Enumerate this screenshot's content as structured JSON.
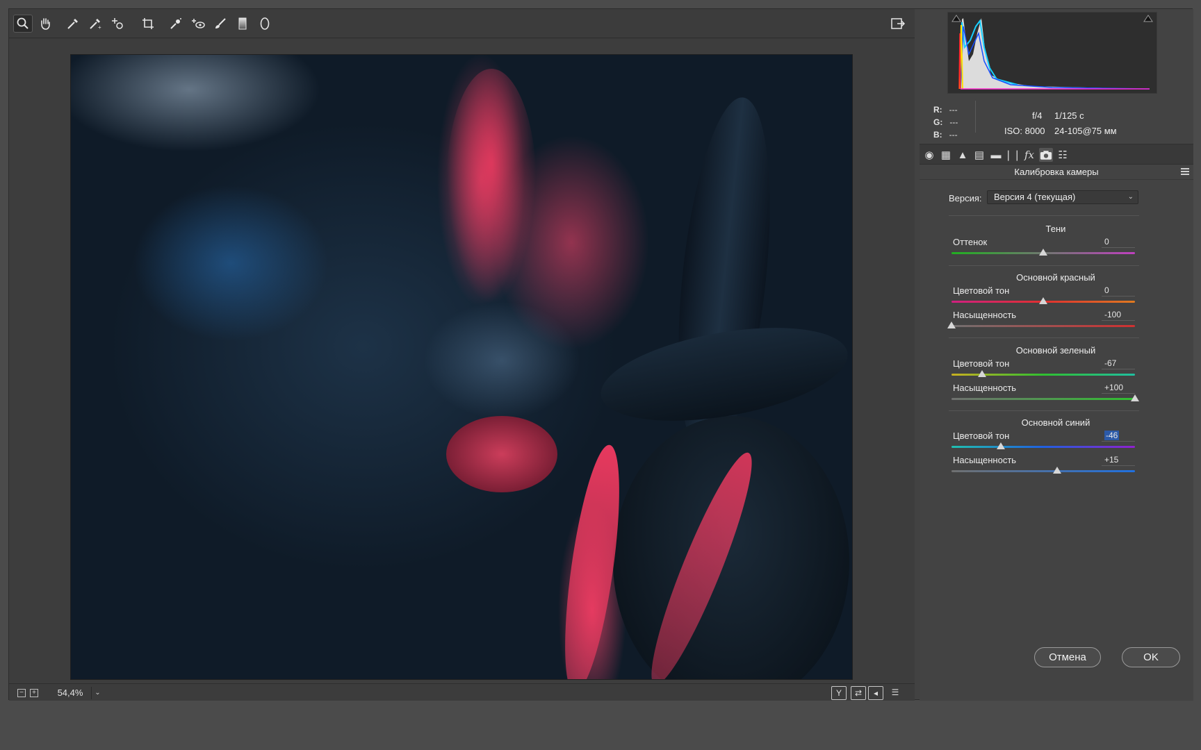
{
  "toolbar": {
    "tools": [
      "zoom-icon",
      "hand-icon",
      "white-balance-icon",
      "color-sampler-icon",
      "targeted-adjustment-icon",
      "crop-icon",
      "spot-removal-icon",
      "red-eye-icon",
      "adjustment-brush-icon",
      "graduated-filter-icon",
      "radial-filter-icon"
    ],
    "open_image_icon": "open-in-photoshop-icon"
  },
  "status_bar": {
    "zoom_out": "−",
    "zoom_in": "+",
    "zoom_value": "54,4%",
    "zoom_dropdown": "⌄"
  },
  "readout": {
    "r_label": "R:",
    "r_value": "---",
    "g_label": "G:",
    "g_value": "---",
    "b_label": "B:",
    "b_value": "---",
    "aperture": "f/4",
    "shutter": "1/125 с",
    "iso": "ISO: 8000",
    "lens": "24-105@75 мм"
  },
  "panel": {
    "title": "Калибровка камеры",
    "version_label": "Версия:",
    "version_value": "Версия 4 (текущая)",
    "sections": [
      {
        "title": "Тени",
        "sliders": [
          {
            "label": "Оттенок",
            "value": "0",
            "min": -100,
            "max": 100,
            "pos": 0
          }
        ]
      },
      {
        "title": "Основной красный",
        "sliders": [
          {
            "label": "Цветовой тон",
            "value": "0",
            "min": -100,
            "max": 100,
            "pos": 0
          },
          {
            "label": "Насыщенность",
            "value": "-100",
            "min": -100,
            "max": 100,
            "pos": -100
          }
        ]
      },
      {
        "title": "Основной зеленый",
        "sliders": [
          {
            "label": "Цветовой тон",
            "value": "-67",
            "min": -100,
            "max": 100,
            "pos": -67
          },
          {
            "label": "Насыщенность",
            "value": "+100",
            "min": -100,
            "max": 100,
            "pos": 100
          }
        ]
      },
      {
        "title": "Основной синий",
        "sliders": [
          {
            "label": "Цветовой тон",
            "value": "-46",
            "min": -100,
            "max": 100,
            "pos": -46
          },
          {
            "label": "Насыщенность",
            "value": "+15",
            "min": -100,
            "max": 100,
            "pos": 15
          }
        ]
      }
    ]
  },
  "buttons": {
    "cancel": "Отмена",
    "ok": "OK"
  },
  "colors": {
    "selection_highlight": "#2c5aa8"
  }
}
